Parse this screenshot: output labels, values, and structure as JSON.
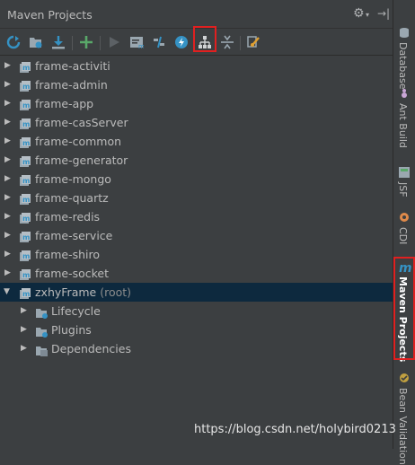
{
  "panel": {
    "title": "Maven Projects"
  },
  "toolbar": {
    "buttons": [
      {
        "name": "reimport-icon"
      },
      {
        "name": "generate-sources-icon"
      },
      {
        "name": "download-icon"
      },
      {
        "name": "add-icon"
      },
      {
        "name": "run-icon"
      },
      {
        "name": "execute-goal-icon"
      },
      {
        "name": "toggle-offline-icon"
      },
      {
        "name": "skip-tests-icon"
      },
      {
        "name": "show-dependencies-icon"
      },
      {
        "name": "collapse-all-icon"
      },
      {
        "name": "settings-icon"
      }
    ]
  },
  "tree": {
    "projects": [
      {
        "label": "frame-activiti"
      },
      {
        "label": "frame-admin"
      },
      {
        "label": "frame-app"
      },
      {
        "label": "frame-casServer"
      },
      {
        "label": "frame-common"
      },
      {
        "label": "frame-generator"
      },
      {
        "label": "frame-mongo"
      },
      {
        "label": "frame-quartz"
      },
      {
        "label": "frame-redis"
      },
      {
        "label": "frame-service"
      },
      {
        "label": "frame-shiro"
      },
      {
        "label": "frame-socket"
      }
    ],
    "root": {
      "label": "zxhyFrame",
      "suffix": "(root)"
    },
    "children": [
      {
        "label": "Lifecycle"
      },
      {
        "label": "Plugins"
      },
      {
        "label": "Dependencies"
      }
    ]
  },
  "rail": {
    "items": [
      {
        "label": "Database"
      },
      {
        "label": "Ant Build"
      },
      {
        "label": "JSF"
      },
      {
        "label": "CDI"
      },
      {
        "label": "Maven Projects"
      },
      {
        "label": "Bean Validation"
      }
    ]
  },
  "watermark": "https://blog.csdn.net/holybird0213",
  "colors": {
    "background": "#3c3f41",
    "selection": "#0d293e",
    "highlight": "#e02020",
    "maven": "#3592c4"
  }
}
